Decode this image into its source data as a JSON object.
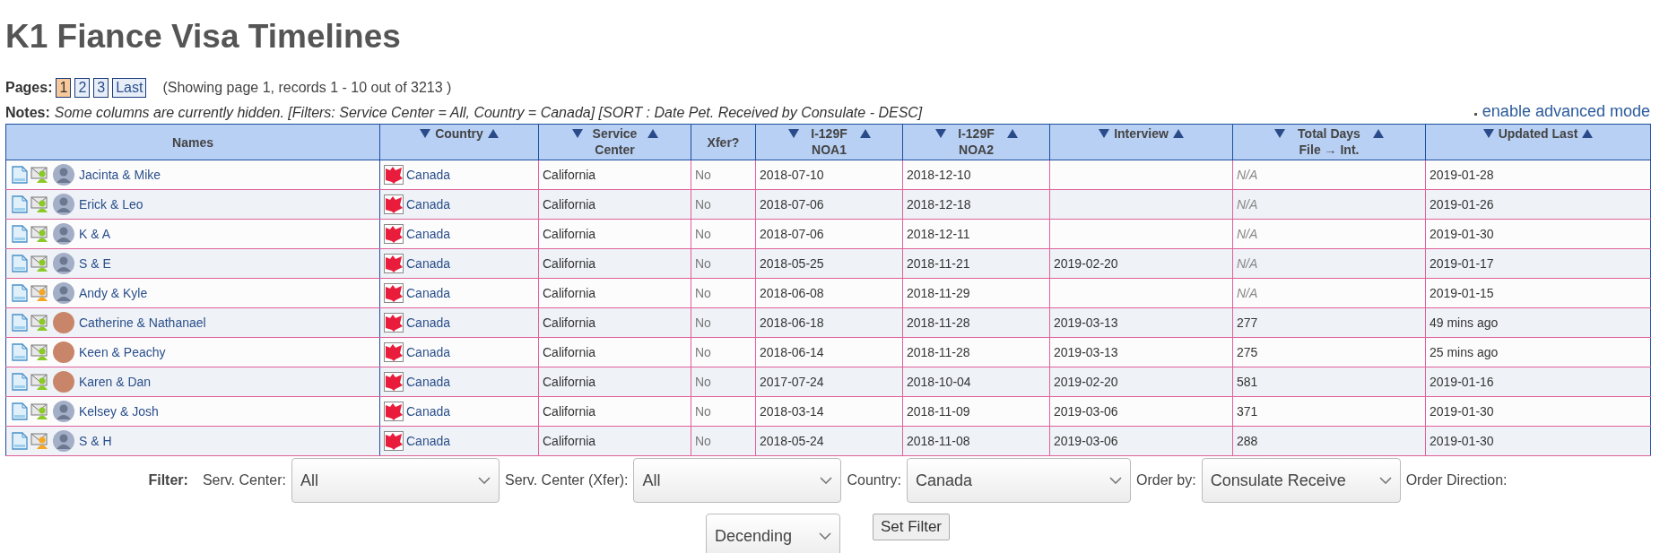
{
  "title": "K1 Fiance Visa Timelines",
  "pages": {
    "label": "Pages:",
    "items": [
      {
        "label": "1",
        "selected": true
      },
      {
        "label": "2",
        "selected": false
      },
      {
        "label": "3",
        "selected": false
      },
      {
        "label": "Last",
        "selected": false
      }
    ],
    "summary": "(Showing page 1, records 1 - 10 out of 3213 )"
  },
  "notes": {
    "label": "Notes:",
    "text": "Some columns are currently hidden. [Filters: Service Center = All, Country = Canada] [SORT : Date Pet. Received by Consulate - DESC]",
    "link": "enable advanced mode"
  },
  "table": {
    "columns": [
      {
        "label": "Names",
        "sortable": false
      },
      {
        "label": "Country",
        "sortable": true
      },
      {
        "label": "Service Center",
        "sortable": true
      },
      {
        "label": "Xfer?",
        "sortable": false
      },
      {
        "label": "I-129F NOA1",
        "sortable": true
      },
      {
        "label": "I-129F NOA2",
        "sortable": true
      },
      {
        "label": "Interview",
        "sortable": true
      },
      {
        "label": "Total Days File → Int.",
        "sortable": true
      },
      {
        "label": "Updated Last",
        "sortable": true
      }
    ],
    "rows": [
      {
        "names": "Jacinta & Mike",
        "color": "#8ac926",
        "kind": "default",
        "country": "Canada",
        "service_center": "California",
        "xfer": "No",
        "noa1": "2018-07-10",
        "noa2": "2018-12-10",
        "interview": "",
        "total_days": "N/A",
        "total_days_muted": true,
        "updated": "2019-01-28"
      },
      {
        "names": "Erick & Leo",
        "color": "#8ac926",
        "kind": "default",
        "country": "Canada",
        "service_center": "California",
        "xfer": "No",
        "noa1": "2018-07-06",
        "noa2": "2018-12-18",
        "interview": "",
        "total_days": "N/A",
        "total_days_muted": true,
        "updated": "2019-01-26"
      },
      {
        "names": "K & A",
        "color": "#8ac926",
        "kind": "default",
        "country": "Canada",
        "service_center": "California",
        "xfer": "No",
        "noa1": "2018-07-06",
        "noa2": "2018-12-11",
        "interview": "",
        "total_days": "N/A",
        "total_days_muted": true,
        "updated": "2019-01-30"
      },
      {
        "names": "S & E",
        "color": "#8ac926",
        "kind": "default",
        "country": "Canada",
        "service_center": "California",
        "xfer": "No",
        "noa1": "2018-05-25",
        "noa2": "2018-11-21",
        "interview": "2019-02-20",
        "total_days": "N/A",
        "total_days_muted": true,
        "updated": "2019-01-17"
      },
      {
        "names": "Andy & Kyle",
        "color": "#f5a623",
        "kind": "default",
        "country": "Canada",
        "service_center": "California",
        "xfer": "No",
        "noa1": "2018-06-08",
        "noa2": "2018-11-29",
        "interview": "",
        "total_days": "N/A",
        "total_days_muted": true,
        "updated": "2019-01-15"
      },
      {
        "names": "Catherine & Nathanael",
        "color": "#8ac926",
        "kind": "photo",
        "country": "Canada",
        "service_center": "California",
        "xfer": "No",
        "noa1": "2018-06-18",
        "noa2": "2018-11-28",
        "interview": "2019-03-13",
        "total_days": "277",
        "total_days_muted": false,
        "updated": "49 mins ago"
      },
      {
        "names": "Keen & Peachy",
        "color": "#8ac926",
        "kind": "photo",
        "country": "Canada",
        "service_center": "California",
        "xfer": "No",
        "noa1": "2018-06-14",
        "noa2": "2018-11-28",
        "interview": "2019-03-13",
        "total_days": "275",
        "total_days_muted": false,
        "updated": "25 mins ago"
      },
      {
        "names": "Karen & Dan",
        "color": "#8ac926",
        "kind": "photo",
        "country": "Canada",
        "service_center": "California",
        "xfer": "No",
        "noa1": "2017-07-24",
        "noa2": "2018-10-04",
        "interview": "2019-02-20",
        "total_days": "581",
        "total_days_muted": false,
        "updated": "2019-01-16"
      },
      {
        "names": "Kelsey & Josh",
        "color": "#8ac926",
        "kind": "default",
        "country": "Canada",
        "service_center": "California",
        "xfer": "No",
        "noa1": "2018-03-14",
        "noa2": "2018-11-09",
        "interview": "2019-03-06",
        "total_days": "371",
        "total_days_muted": false,
        "updated": "2019-01-30"
      },
      {
        "names": "S & H",
        "color": "#f5a623",
        "kind": "default",
        "country": "Canada",
        "service_center": "California",
        "xfer": "No",
        "noa1": "2018-05-24",
        "noa2": "2018-11-08",
        "interview": "2019-03-06",
        "total_days": "288",
        "total_days_muted": false,
        "updated": "2019-01-30"
      }
    ]
  },
  "filter": {
    "label": "Filter:",
    "fields": [
      {
        "label": "Serv. Center:",
        "value": "All"
      },
      {
        "label": "Serv. Center (Xfer):",
        "value": "All"
      },
      {
        "label": "Country:",
        "value": "Canada"
      },
      {
        "label": "Order by:",
        "value": "Consulate Receive"
      },
      {
        "label": "Order Direction:",
        "value": "Decending"
      }
    ],
    "button": "Set Filter"
  }
}
